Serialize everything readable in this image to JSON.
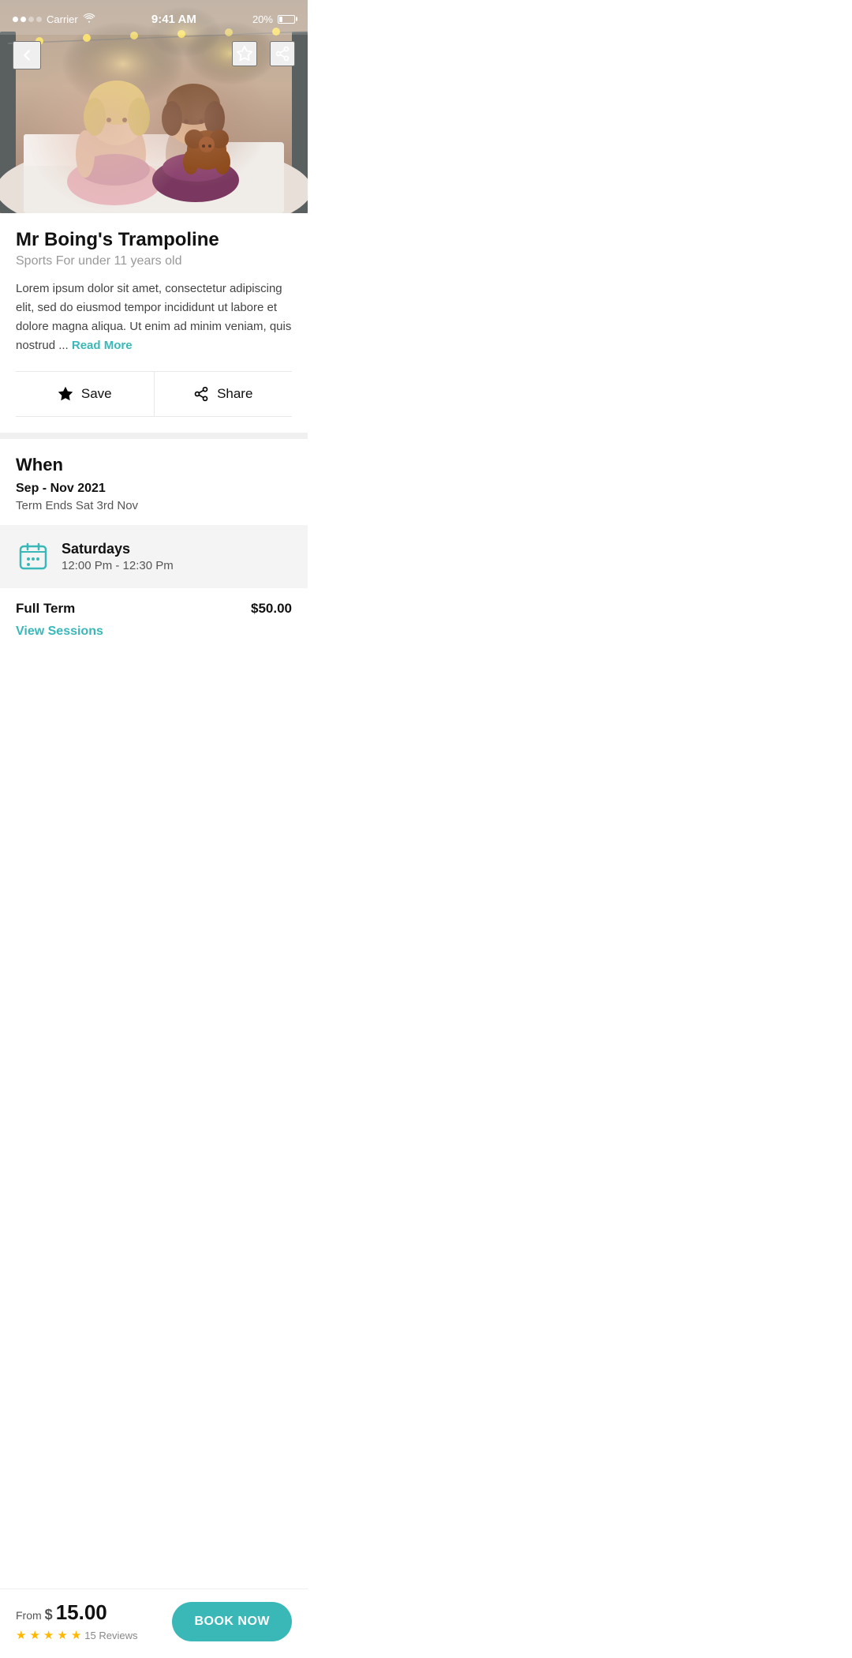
{
  "statusBar": {
    "carrier": "Carrier",
    "time": "9:41 AM",
    "battery": "20%",
    "signalDots": [
      true,
      true,
      false,
      false
    ]
  },
  "hero": {
    "backLabel": "back",
    "saveLabel": "save",
    "shareLabel": "share"
  },
  "detail": {
    "title": "Mr Boing's Trampoline",
    "subtitle": "Sports For under 11 years old",
    "description": "Lorem ipsum dolor sit amet, consectetur adipiscing elit, sed do eiusmod tempor incididunt ut labore et dolore magna aliqua. Ut enim ad minim veniam, quis nostrud ...",
    "readMore": "Read More",
    "saveLabel": "Save",
    "shareLabel": "Share"
  },
  "when": {
    "sectionTitle": "When",
    "dateRange": "Sep - Nov 2021",
    "termEnd": "Term Ends Sat 3rd Nov",
    "schedule": {
      "day": "Saturdays",
      "time": "12:00 Pm - 12:30 Pm"
    },
    "pricing": {
      "label": "Full Term",
      "amount": "$50.00",
      "viewSessions": "View Sessions"
    }
  },
  "bottomBar": {
    "fromLabel": "From",
    "currency": "$",
    "price": "15.00",
    "stars": 5,
    "reviewCount": "15 Reviews",
    "bookNow": "BOOK NOW"
  },
  "colors": {
    "teal": "#3ab8b8",
    "gold": "#FFB800",
    "dark": "#111111",
    "gray": "#999999"
  }
}
